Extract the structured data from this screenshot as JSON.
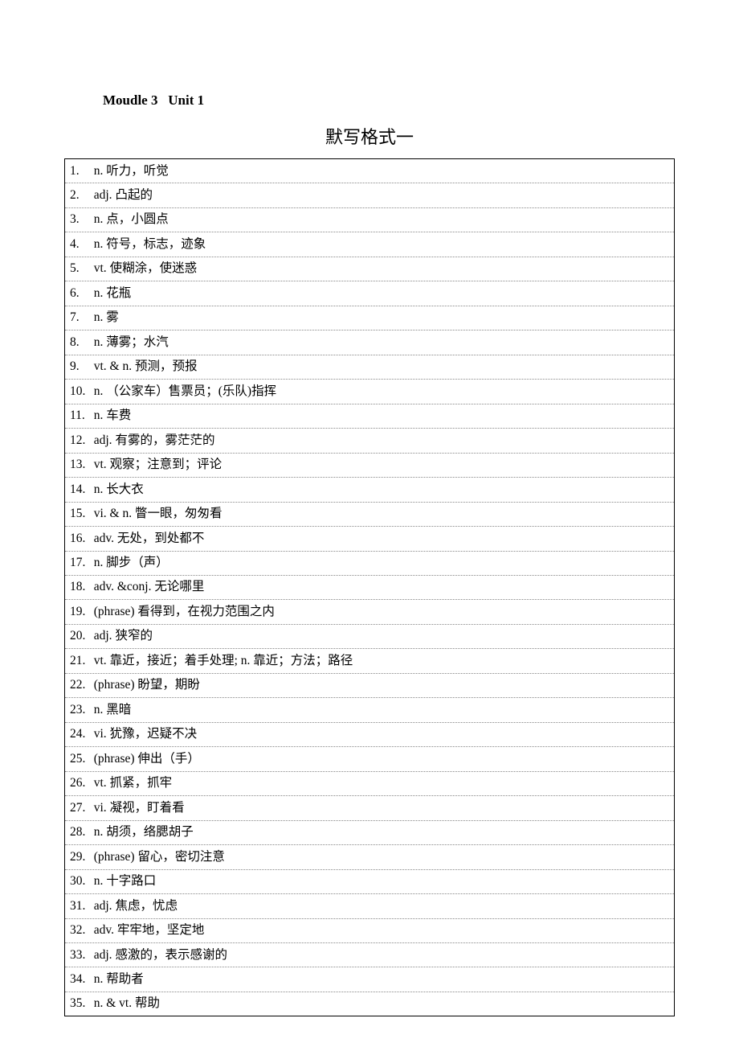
{
  "header": {
    "module": "Moudle 3",
    "unit": "Unit 1"
  },
  "title": "默写格式一",
  "entries": [
    {
      "num": "1.",
      "pos": "n.",
      "def": "听力，听觉"
    },
    {
      "num": "2.",
      "pos": "adj.",
      "def": "凸起的"
    },
    {
      "num": "3.",
      "pos": "n.",
      "def": "点，小圆点"
    },
    {
      "num": "4.",
      "pos": "n.",
      "def": "符号，标志，迹象"
    },
    {
      "num": "5.",
      "pos": "vt.",
      "def": "使糊涂，使迷惑"
    },
    {
      "num": "6.",
      "pos": "n.",
      "def": "花瓶"
    },
    {
      "num": "7.",
      "pos": "n.",
      "def": "雾"
    },
    {
      "num": "8.",
      "pos": "n.",
      "def": "薄雾；水汽"
    },
    {
      "num": "9.",
      "pos": "vt. & n.",
      "def": "预测，预报"
    },
    {
      "num": "10.",
      "pos": "n.",
      "def": "（公家车）售票员；(乐队)指挥"
    },
    {
      "num": "11.",
      "pos": "n.",
      "def": "车费"
    },
    {
      "num": "12.",
      "pos": "adj.",
      "def": "有雾的，雾茫茫的"
    },
    {
      "num": "13.",
      "pos": "vt.",
      "def": "观察；注意到；评论"
    },
    {
      "num": "14.",
      "pos": "n.",
      "def": "长大衣"
    },
    {
      "num": "15.",
      "pos": "vi. & n.",
      "def": "瞥一眼，匆匆看"
    },
    {
      "num": "16.",
      "pos": "adv.",
      "def": "无处，到处都不"
    },
    {
      "num": "17.",
      "pos": "n.",
      "def": "脚步（声）"
    },
    {
      "num": "18.",
      "pos": "adv. &conj.",
      "def": "无论哪里"
    },
    {
      "num": "19.",
      "pos": "(phrase)",
      "def": "看得到，在视力范围之内"
    },
    {
      "num": "20.",
      "pos": "adj.",
      "def": "狭窄的"
    },
    {
      "num": "21.",
      "pos": "vt.",
      "def": "靠近，接近；着手处理; n. 靠近；方法；路径"
    },
    {
      "num": "22.",
      "pos": "(phrase)",
      "def": "盼望，期盼"
    },
    {
      "num": "23.",
      "pos": "n.",
      "def": "黑暗"
    },
    {
      "num": "24.",
      "pos": "vi.",
      "def": "犹豫，迟疑不决"
    },
    {
      "num": "25.",
      "pos": "(phrase)",
      "def": "伸出（手）"
    },
    {
      "num": "26.",
      "pos": "vt.",
      "def": "抓紧，抓牢"
    },
    {
      "num": "27.",
      "pos": "vi.",
      "def": "凝视，盯着看"
    },
    {
      "num": "28.",
      "pos": "n.",
      "def": "胡须，络腮胡子"
    },
    {
      "num": "29.",
      "pos": "(phrase)",
      "def": "留心，密切注意"
    },
    {
      "num": "30.",
      "pos": "n.",
      "def": "十字路口"
    },
    {
      "num": "31.",
      "pos": "adj.",
      "def": "焦虑，忧虑"
    },
    {
      "num": "32.",
      "pos": "adv.",
      "def": "牢牢地，坚定地"
    },
    {
      "num": "33.",
      "pos": "adj.",
      "def": "感激的，表示感谢的"
    },
    {
      "num": "34.",
      "pos": "n.",
      "def": "帮助者"
    },
    {
      "num": "35.",
      "pos": "n. & vt.",
      "def": "帮助"
    }
  ]
}
